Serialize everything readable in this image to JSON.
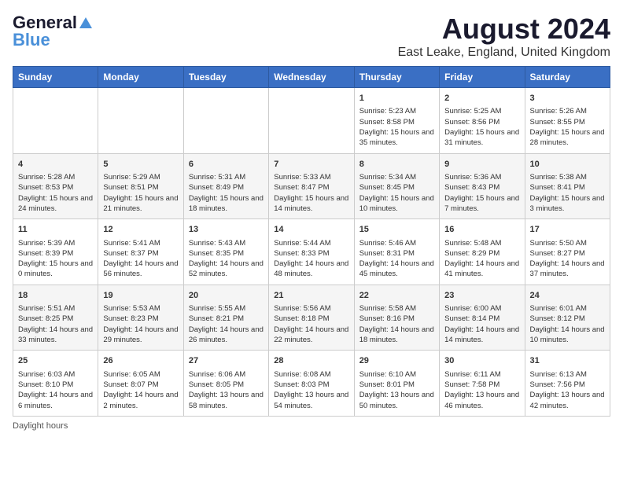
{
  "logo": {
    "line1": "General",
    "line2": "Blue"
  },
  "title": "August 2024",
  "subtitle": "East Leake, England, United Kingdom",
  "days_header": [
    "Sunday",
    "Monday",
    "Tuesday",
    "Wednesday",
    "Thursday",
    "Friday",
    "Saturday"
  ],
  "weeks": [
    [
      {
        "num": "",
        "info": ""
      },
      {
        "num": "",
        "info": ""
      },
      {
        "num": "",
        "info": ""
      },
      {
        "num": "",
        "info": ""
      },
      {
        "num": "1",
        "info": "Sunrise: 5:23 AM\nSunset: 8:58 PM\nDaylight: 15 hours and 35 minutes."
      },
      {
        "num": "2",
        "info": "Sunrise: 5:25 AM\nSunset: 8:56 PM\nDaylight: 15 hours and 31 minutes."
      },
      {
        "num": "3",
        "info": "Sunrise: 5:26 AM\nSunset: 8:55 PM\nDaylight: 15 hours and 28 minutes."
      }
    ],
    [
      {
        "num": "4",
        "info": "Sunrise: 5:28 AM\nSunset: 8:53 PM\nDaylight: 15 hours and 24 minutes."
      },
      {
        "num": "5",
        "info": "Sunrise: 5:29 AM\nSunset: 8:51 PM\nDaylight: 15 hours and 21 minutes."
      },
      {
        "num": "6",
        "info": "Sunrise: 5:31 AM\nSunset: 8:49 PM\nDaylight: 15 hours and 18 minutes."
      },
      {
        "num": "7",
        "info": "Sunrise: 5:33 AM\nSunset: 8:47 PM\nDaylight: 15 hours and 14 minutes."
      },
      {
        "num": "8",
        "info": "Sunrise: 5:34 AM\nSunset: 8:45 PM\nDaylight: 15 hours and 10 minutes."
      },
      {
        "num": "9",
        "info": "Sunrise: 5:36 AM\nSunset: 8:43 PM\nDaylight: 15 hours and 7 minutes."
      },
      {
        "num": "10",
        "info": "Sunrise: 5:38 AM\nSunset: 8:41 PM\nDaylight: 15 hours and 3 minutes."
      }
    ],
    [
      {
        "num": "11",
        "info": "Sunrise: 5:39 AM\nSunset: 8:39 PM\nDaylight: 15 hours and 0 minutes."
      },
      {
        "num": "12",
        "info": "Sunrise: 5:41 AM\nSunset: 8:37 PM\nDaylight: 14 hours and 56 minutes."
      },
      {
        "num": "13",
        "info": "Sunrise: 5:43 AM\nSunset: 8:35 PM\nDaylight: 14 hours and 52 minutes."
      },
      {
        "num": "14",
        "info": "Sunrise: 5:44 AM\nSunset: 8:33 PM\nDaylight: 14 hours and 48 minutes."
      },
      {
        "num": "15",
        "info": "Sunrise: 5:46 AM\nSunset: 8:31 PM\nDaylight: 14 hours and 45 minutes."
      },
      {
        "num": "16",
        "info": "Sunrise: 5:48 AM\nSunset: 8:29 PM\nDaylight: 14 hours and 41 minutes."
      },
      {
        "num": "17",
        "info": "Sunrise: 5:50 AM\nSunset: 8:27 PM\nDaylight: 14 hours and 37 minutes."
      }
    ],
    [
      {
        "num": "18",
        "info": "Sunrise: 5:51 AM\nSunset: 8:25 PM\nDaylight: 14 hours and 33 minutes."
      },
      {
        "num": "19",
        "info": "Sunrise: 5:53 AM\nSunset: 8:23 PM\nDaylight: 14 hours and 29 minutes."
      },
      {
        "num": "20",
        "info": "Sunrise: 5:55 AM\nSunset: 8:21 PM\nDaylight: 14 hours and 26 minutes."
      },
      {
        "num": "21",
        "info": "Sunrise: 5:56 AM\nSunset: 8:18 PM\nDaylight: 14 hours and 22 minutes."
      },
      {
        "num": "22",
        "info": "Sunrise: 5:58 AM\nSunset: 8:16 PM\nDaylight: 14 hours and 18 minutes."
      },
      {
        "num": "23",
        "info": "Sunrise: 6:00 AM\nSunset: 8:14 PM\nDaylight: 14 hours and 14 minutes."
      },
      {
        "num": "24",
        "info": "Sunrise: 6:01 AM\nSunset: 8:12 PM\nDaylight: 14 hours and 10 minutes."
      }
    ],
    [
      {
        "num": "25",
        "info": "Sunrise: 6:03 AM\nSunset: 8:10 PM\nDaylight: 14 hours and 6 minutes."
      },
      {
        "num": "26",
        "info": "Sunrise: 6:05 AM\nSunset: 8:07 PM\nDaylight: 14 hours and 2 minutes."
      },
      {
        "num": "27",
        "info": "Sunrise: 6:06 AM\nSunset: 8:05 PM\nDaylight: 13 hours and 58 minutes."
      },
      {
        "num": "28",
        "info": "Sunrise: 6:08 AM\nSunset: 8:03 PM\nDaylight: 13 hours and 54 minutes."
      },
      {
        "num": "29",
        "info": "Sunrise: 6:10 AM\nSunset: 8:01 PM\nDaylight: 13 hours and 50 minutes."
      },
      {
        "num": "30",
        "info": "Sunrise: 6:11 AM\nSunset: 7:58 PM\nDaylight: 13 hours and 46 minutes."
      },
      {
        "num": "31",
        "info": "Sunrise: 6:13 AM\nSunset: 7:56 PM\nDaylight: 13 hours and 42 minutes."
      }
    ]
  ],
  "footer": "Daylight hours"
}
